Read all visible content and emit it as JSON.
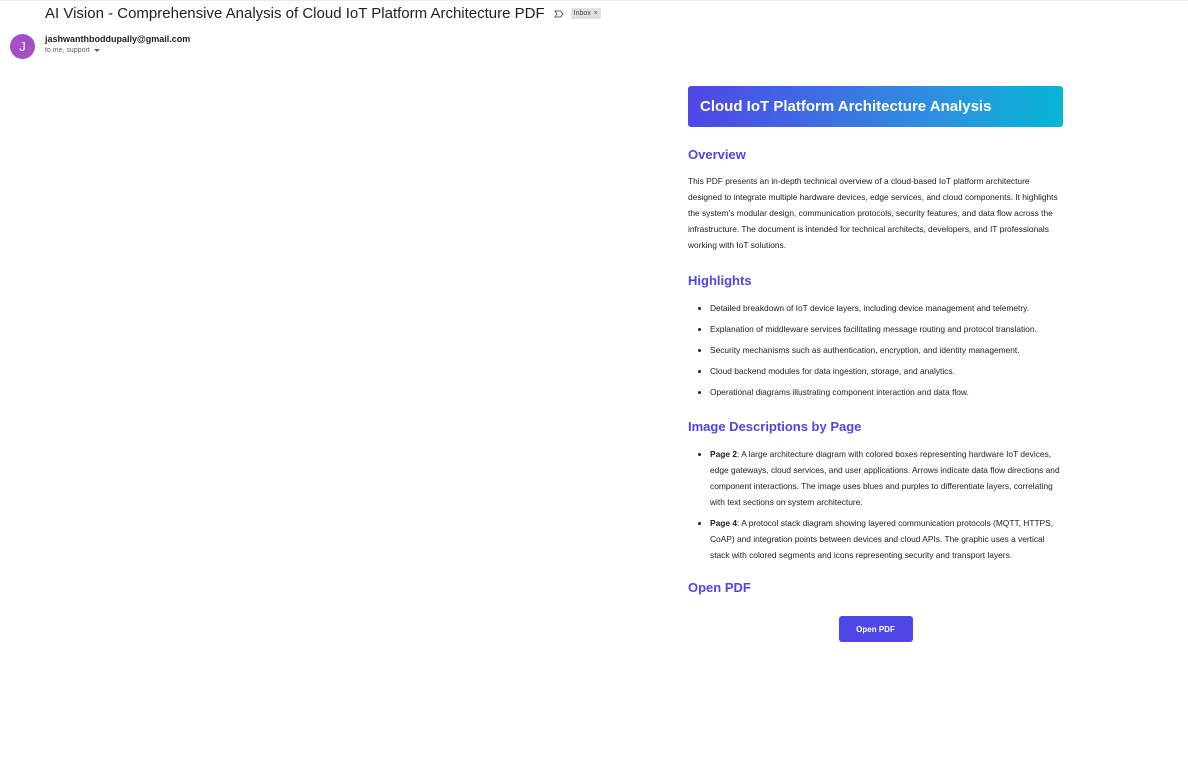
{
  "email": {
    "subject": "AI Vision - Comprehensive Analysis of Cloud IoT Platform Architecture PDF",
    "label_chip": "Inbox",
    "label_chip_close": "×",
    "avatar_letter": "J",
    "avatar_color": "#a54fc6",
    "sender": "jashwanthboddupally@gmail.com",
    "recipients": "to me, support"
  },
  "report": {
    "banner_title": "Cloud IoT Platform Architecture Analysis",
    "overview": {
      "heading": "Overview",
      "text": "This PDF presents an in-depth technical overview of a cloud-based IoT platform architecture designed to integrate multiple hardware devices, edge services, and cloud components. It highlights the system’s modular design, communication protocols, security features, and data flow across the infrastructure. The document is intended for technical architects, developers, and IT professionals working with IoT solutions."
    },
    "highlights": {
      "heading": "Highlights",
      "items": [
        "Detailed breakdown of IoT device layers, including device management and telemetry.",
        "Explanation of middleware services facilitating message routing and protocol translation.",
        "Security mechanisms such as authentication, encryption, and identity management.",
        "Cloud backend modules for data ingestion, storage, and analytics.",
        "Operational diagrams illustrating component interaction and data flow."
      ]
    },
    "image_descriptions": {
      "heading": "Image Descriptions by Page",
      "items": [
        {
          "page": "Page 2",
          "text": ": A large architecture diagram with colored boxes representing hardware IoT devices, edge gateways, cloud services, and user applications. Arrows indicate data flow directions and component interactions. The image uses blues and purples to differentiate layers, correlating with text sections on system architecture."
        },
        {
          "page": "Page 4",
          "text": ": A protocol stack diagram showing layered communication protocols (MQTT, HTTPS, CoAP) and integration points between devices and cloud APIs. The graphic uses a vertical stack with colored segments and icons representing security and transport layers."
        }
      ]
    },
    "open_pdf": {
      "heading": "Open PDF",
      "button_label": "Open PDF"
    }
  },
  "colors": {
    "accent": "#4f46e5",
    "banner_gradient_end": "#06b6d4"
  }
}
